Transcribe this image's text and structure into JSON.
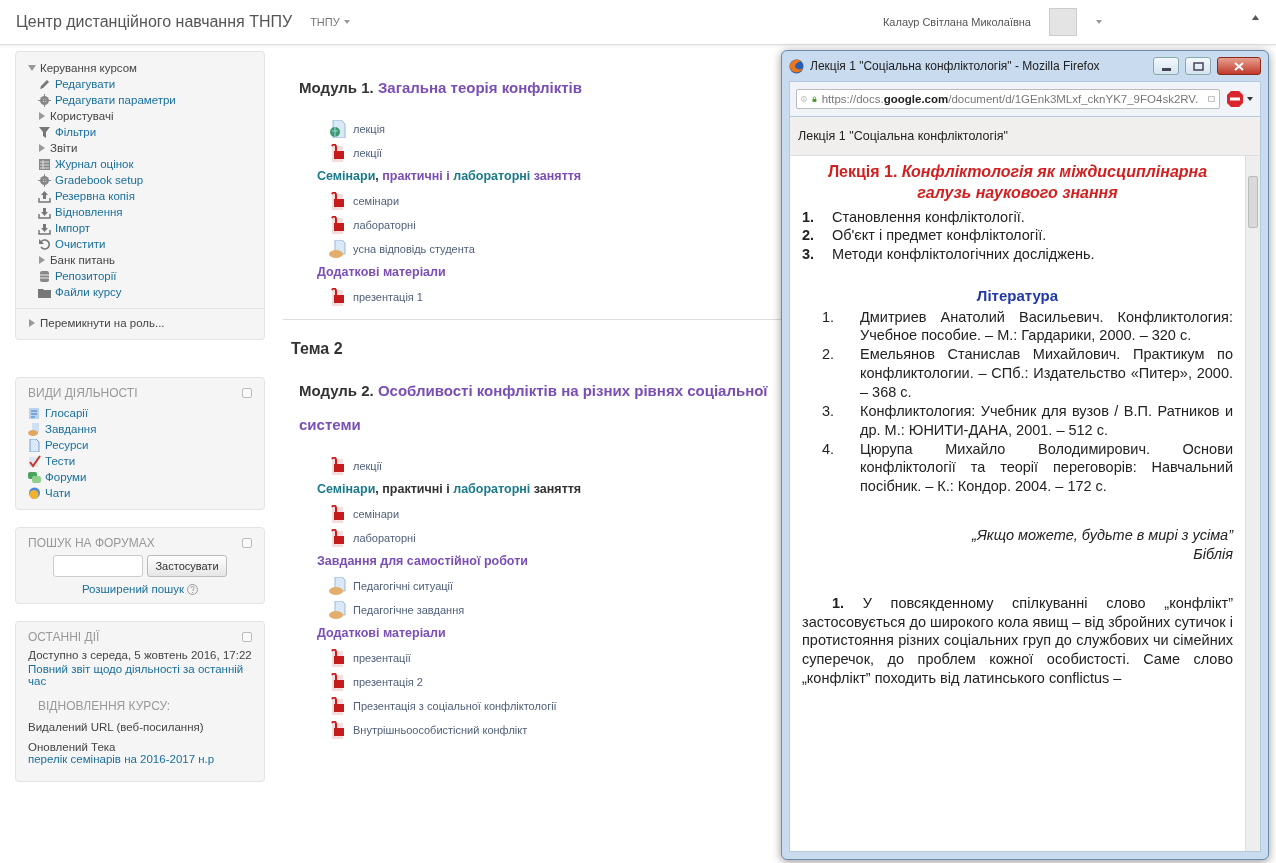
{
  "header": {
    "site_name": "Центр дистанційного навчання ТНПУ",
    "menu": "ТНПУ",
    "user_name": "Калаур Світлана Миколаївна"
  },
  "sidebar": {
    "admin": {
      "title": "Керування курсом",
      "expanded": true,
      "items": [
        {
          "kind": "edit",
          "label": "Редагувати"
        },
        {
          "kind": "settings",
          "label": "Редагувати параметри"
        },
        {
          "kind": "branch",
          "label": "Користувачі",
          "expanded": false
        },
        {
          "kind": "filter",
          "label": "Фільтри"
        },
        {
          "kind": "branch",
          "label": "Звіти",
          "expanded": false
        },
        {
          "kind": "grades",
          "label": "Журнал оцінок"
        },
        {
          "kind": "settings",
          "label": "Gradebook setup"
        },
        {
          "kind": "backup",
          "label": "Резервна копія"
        },
        {
          "kind": "restore",
          "label": "Відновлення"
        },
        {
          "kind": "restore",
          "label": "Імпорт"
        },
        {
          "kind": "reset",
          "label": "Очистити"
        },
        {
          "kind": "branch",
          "label": "Банк питань",
          "expanded": false
        },
        {
          "kind": "repository",
          "label": "Репозиторії"
        },
        {
          "kind": "files",
          "label": "Файли курсу"
        }
      ],
      "switch_role": {
        "label": "Перемикнути на роль...",
        "expanded": false
      }
    },
    "activities": {
      "title": "ВИДИ ДІЯЛЬНОСТІ",
      "items": [
        {
          "kind": "glossary",
          "label": "Глосарії"
        },
        {
          "kind": "assignment",
          "label": "Завдання"
        },
        {
          "kind": "resource",
          "label": "Ресурси"
        },
        {
          "kind": "quiz",
          "label": "Тести"
        },
        {
          "kind": "forum",
          "label": "Форуми"
        },
        {
          "kind": "chat",
          "label": "Чати"
        }
      ]
    },
    "forum_search": {
      "title": "ПОШУК НА ФОРУМАХ",
      "button": "Застосувати",
      "advanced_link": "Розширений пошук"
    },
    "recent": {
      "title": "ОСТАННІ ДІЇ",
      "since": "Доступно з середа, 5 жовтень 2016, 17:22",
      "report_link": "Повний звіт щодо діяльності за останній час",
      "subheading": "ВІДНОВЛЕННЯ КУРСУ:",
      "entries": [
        {
          "text": "Видалений URL (веб-посилання)"
        },
        {
          "text": "Оновлений Тека",
          "link": "перелік семінарів на 2016-2017 н.р"
        }
      ]
    }
  },
  "sections": [
    {
      "modules": [
        {
          "prefix": "Модуль 1.",
          "name": "Загальна теорія конфліктів",
          "items": [
            {
              "kind": "url",
              "label": "лекція"
            },
            {
              "kind": "pdf",
              "label": "лекції"
            },
            {
              "kind": "label",
              "parts": [
                {
                  "kind": "link",
                  "text": "Семінари"
                },
                {
                  "kind": "plain",
                  "text": ", "
                },
                {
                  "kind": "visited",
                  "text": "практичні і "
                },
                {
                  "kind": "link",
                  "text": "лабораторні"
                },
                {
                  "kind": "visited",
                  "text": " заняття"
                }
              ]
            },
            {
              "kind": "pdf",
              "label": "семінари"
            },
            {
              "kind": "pdf",
              "label": "лабораторні"
            },
            {
              "kind": "assign",
              "label": "усна відповідь студента"
            },
            {
              "kind": "label",
              "parts": [
                {
                  "kind": "visited",
                  "text": "Додаткові матеріали"
                }
              ]
            },
            {
              "kind": "pdf",
              "label": "презентація 1"
            }
          ]
        }
      ]
    },
    {
      "title": "Тема 2",
      "modules": [
        {
          "prefix": "Модуль 2.",
          "name": "Особливості конфліктів на різних рівнях соціальної системи",
          "items": [
            {
              "kind": "pdf",
              "label": "лекції"
            },
            {
              "kind": "label",
              "parts": [
                {
                  "kind": "link",
                  "text": "Семінари"
                },
                {
                  "kind": "plain",
                  "text": ", практичні і "
                },
                {
                  "kind": "link",
                  "text": "лабораторні"
                },
                {
                  "kind": "plain",
                  "text": " заняття"
                }
              ]
            },
            {
              "kind": "pdf",
              "label": "семінари"
            },
            {
              "kind": "pdf",
              "label": "лабораторні"
            },
            {
              "kind": "label",
              "parts": [
                {
                  "kind": "visited",
                  "text": "Завдання для самостійної роботи"
                }
              ]
            },
            {
              "kind": "assign",
              "label": "Педагогічні ситуації"
            },
            {
              "kind": "assign",
              "label": "Педагогічне завдання"
            },
            {
              "kind": "label",
              "parts": [
                {
                  "kind": "visited",
                  "text": "Додаткові матеріали"
                }
              ]
            },
            {
              "kind": "pdf",
              "label": "презентації"
            },
            {
              "kind": "pdf",
              "label": "презентація 2"
            },
            {
              "kind": "pdf",
              "label": "Презентація з соціальної конфліктології"
            },
            {
              "kind": "pdf",
              "label": "Внутрішньоособистісний конфлікт"
            }
          ]
        }
      ]
    }
  ],
  "popup": {
    "title": "Лекція 1 \"Соціальна конфліктологія\" - Mozilla Firefox",
    "url": {
      "prefix": "https://docs.",
      "domain": "google.com",
      "path": "/document/d/1GEnk3MLxf_cknYK7_9FO4sk2RV."
    },
    "doc_title": "Лекція 1 \"Соціальна конфліктологія\"",
    "document": {
      "heading": "Лекція 1. *Конфліктологія як міждисциплінарна галузь наукового знання*",
      "outline": [
        {
          "number": "1.",
          "text": "Становлення конфліктології."
        },
        {
          "number": "2.",
          "text": "Об'єкт і предмет конфліктології."
        },
        {
          "number": "3.",
          "text": "Методи конфліктологічних досліджень."
        }
      ],
      "literature_title": "Література",
      "literature": [
        {
          "number": "1.",
          "text": "Дмитриев Анатолий Васильевич. Конфликтология: Учебное пособие. – М.: Гардарики, 2000. – 320 с."
        },
        {
          "number": "2.",
          "text": "Емельянов Станислав Михайлович. Практикум по конфликтологии. – СПб.: Издательство «Питер», 2000. – 368 с."
        },
        {
          "number": "3.",
          "text": "Конфликтология: Учебник для вузов / В.П. Ратников и др. М.: ЮНИТИ-ДАНА, 2001. – 512 с."
        },
        {
          "number": "4.",
          "text": "Цюрупа Михайло Володимирович. Основи конфліктології та теорії переговорів: Навчальний посібник. – К.: Кондор. 2004. – 172 с."
        }
      ],
      "epigraph": "„Якщо можете, будьте в мирі з усіма”",
      "epigraph_source": "Біблія",
      "paragraph": "**1.** У повсякденному спілкуванні слово „конфлікт” застосовується до широкого кола явищ – від збройних сутичок і протистояння різних соціальних груп до службових чи сімейних суперечок, до проблем кожної особистості. Саме слово „конфлікт” походить від латинського conflictus –"
    }
  }
}
